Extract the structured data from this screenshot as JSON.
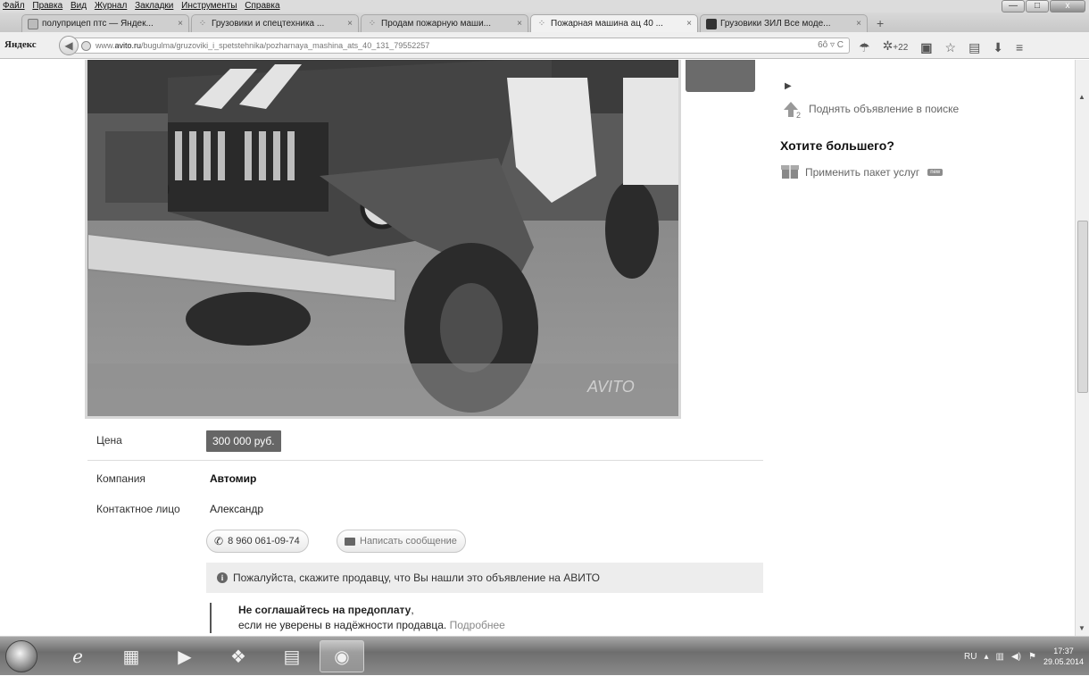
{
  "menubar": {
    "items": [
      "Файл",
      "Правка",
      "Вид",
      "Журнал",
      "Закладки",
      "Инструменты",
      "Справка"
    ]
  },
  "window_buttons": {
    "minimize": "—",
    "maximize": "□",
    "close": "x"
  },
  "tabs": [
    {
      "title": "полуприцеп птс — Яндек...",
      "icon": "yandex-icon",
      "active": false
    },
    {
      "title": "Грузовики и спецтехника ...",
      "icon": "avito-icon",
      "active": false
    },
    {
      "title": "Продам пожарную маши...",
      "icon": "avito-icon",
      "active": false
    },
    {
      "title": "Пожарная машина ац 40 ...",
      "icon": "avito-icon",
      "active": true
    },
    {
      "title": "Грузовики ЗИЛ Все моде...",
      "icon": "site-icon",
      "active": false
    }
  ],
  "navbar": {
    "brand": "Яндекс",
    "url_prefix": "www.",
    "url_host": "avito.ru",
    "url_path": "/bugulma/gruzoviki_i_spetstehnika/pozharnaya_mashina_ats_40_131_79552257",
    "url_right": "6ô ▿ C",
    "extensions_count": "+22"
  },
  "sidebar": {
    "lift_label": "Поднять объявление в поиске",
    "more_title": "Хотите большего?",
    "package_label": "Применить пакет услуг",
    "package_badge": "new"
  },
  "listing": {
    "photo_watermark": "AVITO",
    "price_label": "Цена",
    "price_value": "300 000 руб.",
    "company_label": "Компания",
    "company_value": "Автомир",
    "contact_label": "Контактное лицо",
    "contact_value": "Александр",
    "phone_button": "8 960 061-09-74",
    "message_button": "Написать сообщение",
    "notice": "Пожалуйста, скажите продавцу, что Вы нашли это объявление на АВИТО",
    "warn_bold": "Не соглашайтесь на предоплату",
    "warn_comma": ",",
    "warn_text": "если не уверены в надёжности продавца.",
    "warn_link": "Подробнее"
  },
  "taskbar": {
    "language": "RU",
    "time": "17:37",
    "date": "29.05.2014"
  }
}
